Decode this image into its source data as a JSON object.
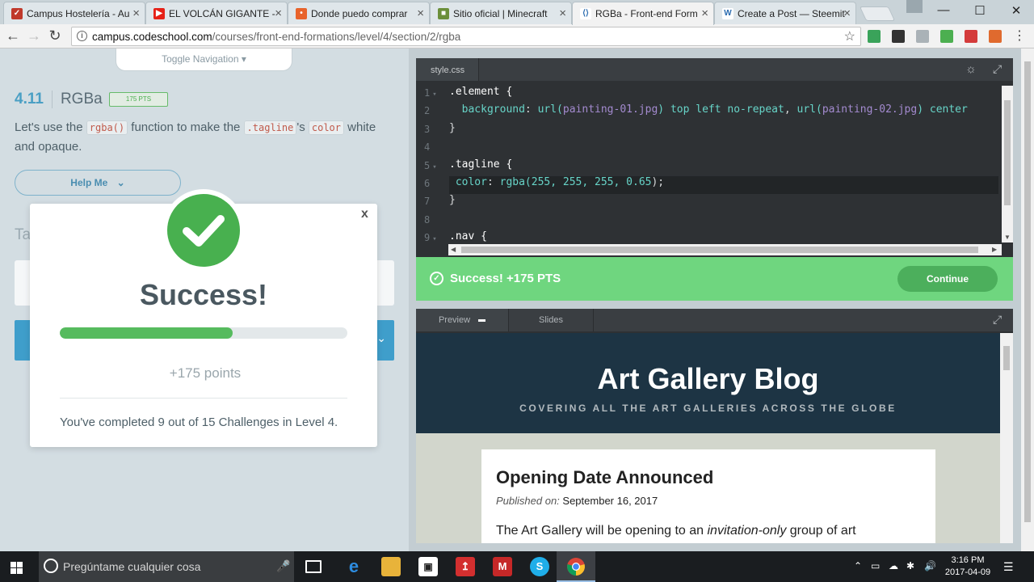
{
  "browser": {
    "tabs": [
      {
        "title": "Campus Hostelería - Au",
        "icon": "hosteleria-favicon",
        "color": "#c0392b",
        "glyph": "✓"
      },
      {
        "title": "EL VOLCÁN GIGANTE -",
        "icon": "youtube-favicon",
        "color": "#e62117",
        "glyph": "▶"
      },
      {
        "title": "Donde puedo comprar",
        "icon": "taringa-favicon",
        "color": "#e8632b",
        "glyph": "•"
      },
      {
        "title": "Sitio oficial | Minecraft",
        "icon": "minecraft-favicon",
        "color": "#6b8f3a",
        "glyph": "■"
      },
      {
        "title": "RGBa - Front-end Form",
        "icon": "codeschool-favicon",
        "color": "#ffffff",
        "glyph": "⟨⟩"
      },
      {
        "title": "Create a Post — Steemit",
        "icon": "steemit-favicon",
        "color": "#ffffff",
        "glyph": "W"
      }
    ],
    "active_tab": 4,
    "url_host": "campus.codeschool.com",
    "url_path": "/courses/front-end-formations/level/4/section/2/rgba",
    "window_controls": {
      "minimize": "—",
      "maximize": "☐",
      "close": "✕"
    }
  },
  "left": {
    "toggle_nav": "Toggle Navigation ▾",
    "challenge_number": "4.11",
    "challenge_title": "RGBa",
    "points_badge": "175 PTS",
    "instructions": {
      "part1": "Let's use the ",
      "code1": "rgba()",
      "part2": " function to make the ",
      "code2": ".tagline",
      "part3": "'s ",
      "code3": "color",
      "part4": " white and opaque."
    },
    "help_me": "Help Me",
    "background_partial": "Ta"
  },
  "modal": {
    "close": "x",
    "title": "Success!",
    "progress_fraction": 0.6,
    "points": "+175 points",
    "completed": "You've completed 9 out of 15 Challenges in Level 4."
  },
  "editor": {
    "file_tab": "style.css",
    "line_numbers": [
      "1",
      "2",
      "3",
      "4",
      "5",
      "6",
      "7",
      "8",
      "9"
    ],
    "fold_marks": [
      "▾",
      "",
      "",
      "",
      "▾",
      "",
      "",
      "",
      "▾"
    ],
    "lines": [
      [
        {
          "t": ".element {",
          "c": "k-sel"
        }
      ],
      [
        {
          "t": "  background",
          "c": "k-prop"
        },
        {
          "t": ": ",
          "c": ""
        },
        {
          "t": "url(",
          "c": "k-fn"
        },
        {
          "t": "painting-01.jpg",
          "c": "k-str"
        },
        {
          "t": ") top left no-repeat",
          "c": "k-fn"
        },
        {
          "t": ", ",
          "c": ""
        },
        {
          "t": "url(",
          "c": "k-fn"
        },
        {
          "t": "painting-02.jpg",
          "c": "k-str"
        },
        {
          "t": ") center",
          "c": "k-fn"
        }
      ],
      [
        {
          "t": "}",
          "c": ""
        }
      ],
      [
        {
          "t": "",
          "c": ""
        }
      ],
      [
        {
          "t": ".tagline {",
          "c": "k-sel"
        }
      ],
      [
        {
          "t": " color",
          "c": "k-prop"
        },
        {
          "t": ": ",
          "c": ""
        },
        {
          "t": "rgba(",
          "c": "k-fn"
        },
        {
          "t": "255, 255, 255, 0.65",
          "c": "k-num"
        },
        {
          "t": ");",
          "c": ""
        }
      ],
      [
        {
          "t": "}",
          "c": ""
        }
      ],
      [
        {
          "t": "",
          "c": ""
        }
      ],
      [
        {
          "t": ".nav {",
          "c": "k-sel"
        }
      ]
    ],
    "highlight_line": 6,
    "success_text": "Success! +175 PTS",
    "continue_label": "Continue"
  },
  "preview": {
    "tabs": [
      "Preview",
      "Slides"
    ],
    "blog_title": "Art Gallery Blog",
    "tagline": "COVERING ALL THE ART GALLERIES ACROSS THE GLOBE",
    "article_title": "Opening Date Announced",
    "published_label": "Published on:",
    "published_date": "September 16, 2017",
    "body_start": "The Art Gallery will be opening to an ",
    "body_em": "invitation-only",
    "body_end": " group of art"
  },
  "taskbar": {
    "search_placeholder": "Pregúntame cualquier cosa",
    "time": "3:16 PM",
    "date": "2017-04-09"
  }
}
